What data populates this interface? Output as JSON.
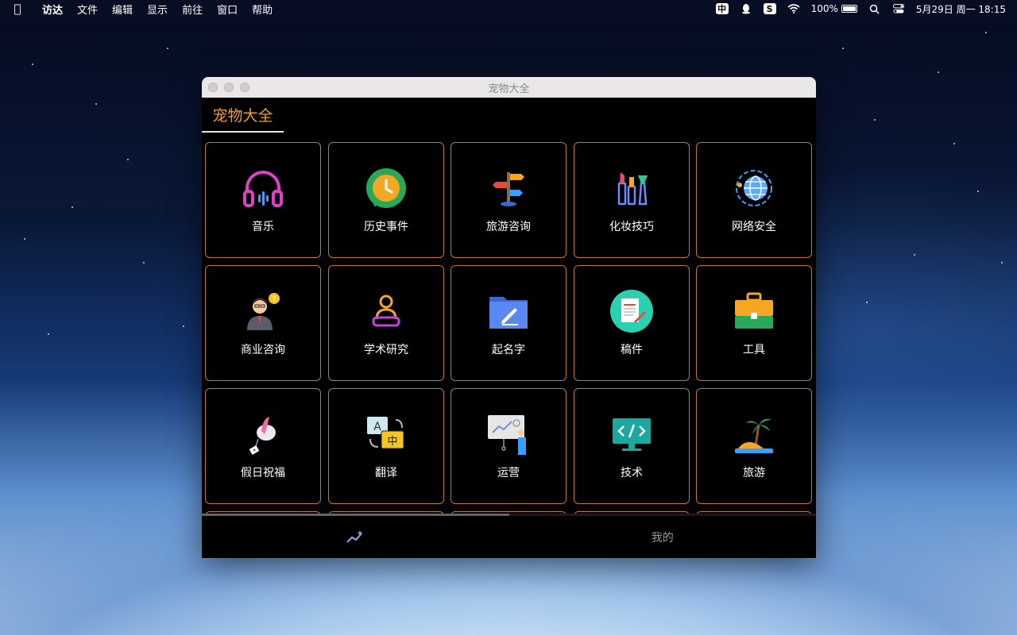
{
  "menubar": {
    "app_name": "访达",
    "items": [
      "文件",
      "编辑",
      "显示",
      "前往",
      "窗口",
      "帮助"
    ],
    "input_method": "中",
    "battery": "100%",
    "datetime": "5月29日 周一  18:15"
  },
  "window": {
    "title": "宠物大全",
    "app_tab": "宠物大全"
  },
  "grid": {
    "border_color": "#c47a18",
    "items": [
      {
        "label": "音乐",
        "icon": "headphones-icon"
      },
      {
        "label": "历史事件",
        "icon": "clock-icon"
      },
      {
        "label": "旅游咨询",
        "icon": "signpost-icon"
      },
      {
        "label": "化妆技巧",
        "icon": "makeup-icon"
      },
      {
        "label": "网络安全",
        "icon": "globe-icon"
      },
      {
        "label": "商业咨询",
        "icon": "businessman-icon"
      },
      {
        "label": "学术研究",
        "icon": "study-icon"
      },
      {
        "label": "起名字",
        "icon": "folder-pen-icon"
      },
      {
        "label": "稿件",
        "icon": "document-icon"
      },
      {
        "label": "工具",
        "icon": "toolbox-icon"
      },
      {
        "label": "假日祝福",
        "icon": "blessing-icon"
      },
      {
        "label": "翻译",
        "icon": "translate-icon"
      },
      {
        "label": "运营",
        "icon": "presentation-icon"
      },
      {
        "label": "技术",
        "icon": "code-monitor-icon"
      },
      {
        "label": "旅游",
        "icon": "island-icon"
      }
    ]
  },
  "tabbar": {
    "tab_discover_icon": "sparkle-chart-icon",
    "tab_mine_label": "我的"
  },
  "scroll": {
    "position_fraction": 0.5
  },
  "colors": {
    "accent": "#f0a020"
  }
}
